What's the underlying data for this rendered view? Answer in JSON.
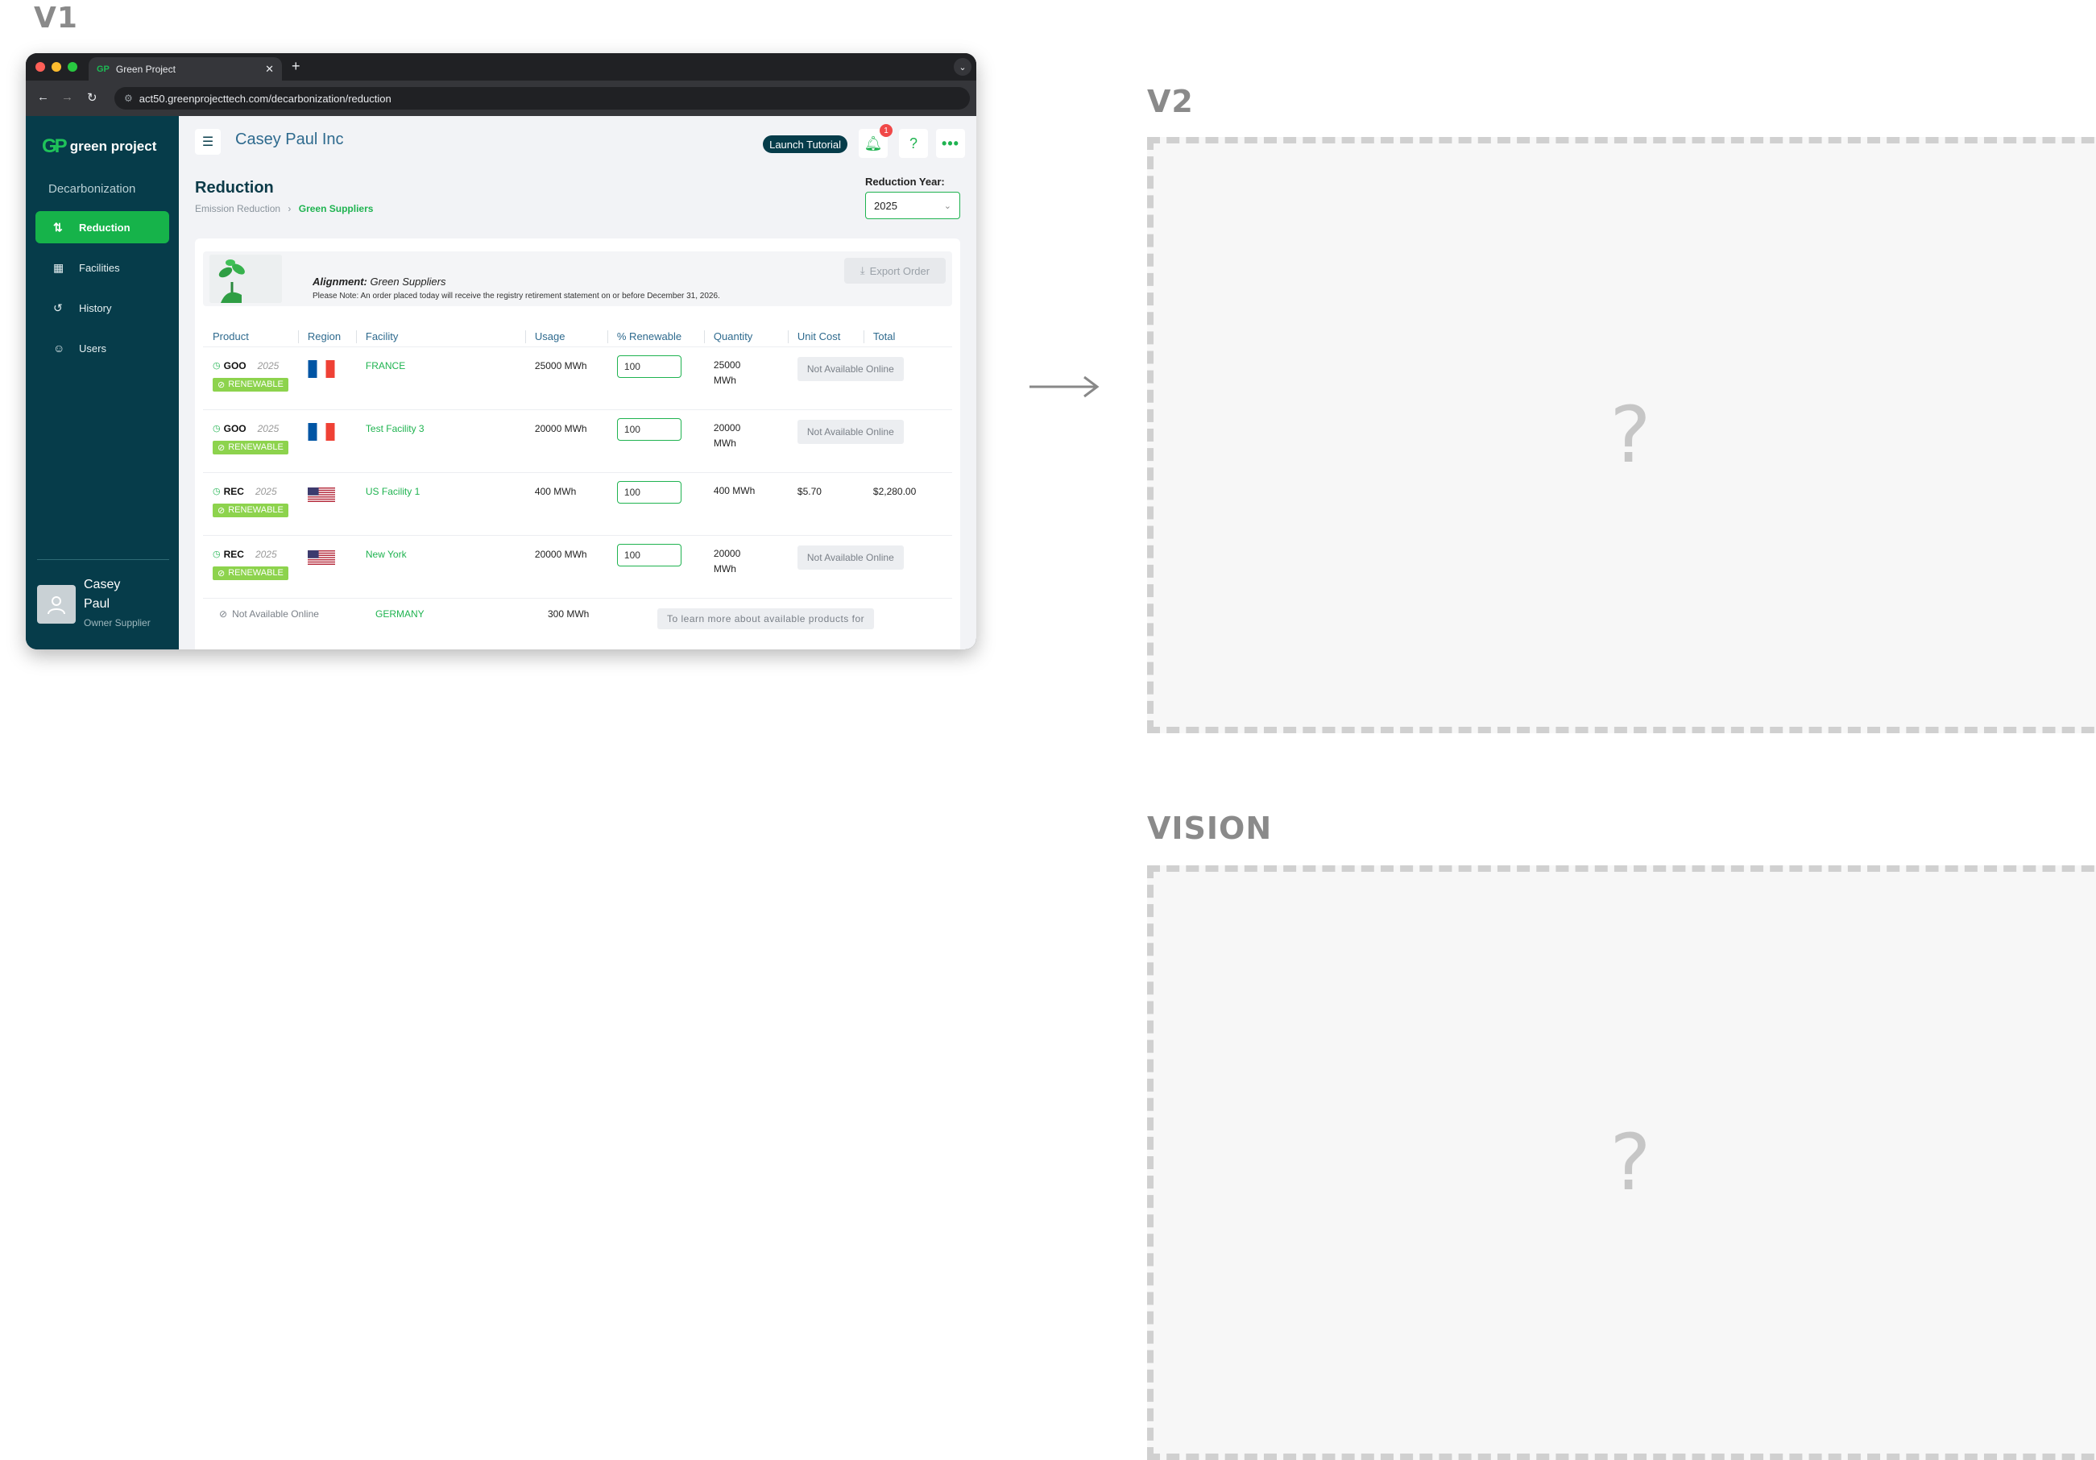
{
  "labels": {
    "v1": "V1",
    "v2": "V2",
    "vision": "VISION",
    "placeholder_mark": "?"
  },
  "browser": {
    "tab_title": "Green Project",
    "tab_favicon": "GP",
    "url": "act50.greenprojecttech.com/decarbonization/reduction"
  },
  "sidebar": {
    "logo_mark": "GP",
    "logo_text": "green project",
    "section": "Decarbonization",
    "items": [
      {
        "label": "Reduction",
        "icon": "reduction-icon",
        "active": true
      },
      {
        "label": "Facilities",
        "icon": "building-icon",
        "active": false
      },
      {
        "label": "History",
        "icon": "history-icon",
        "active": false
      },
      {
        "label": "Users",
        "icon": "user-icon",
        "active": false
      }
    ],
    "user": {
      "name": "Casey Paul",
      "role": "Owner Supplier"
    }
  },
  "header": {
    "company": "Casey Paul Inc",
    "launch_tutorial": "Launch Tutorial",
    "notification_count": "1"
  },
  "page": {
    "title": "Reduction",
    "breadcrumb": [
      "Emission Reduction",
      "Green Suppliers"
    ],
    "year_label": "Reduction Year:",
    "year_value": "2025"
  },
  "info": {
    "alignment_label": "Alignment:",
    "alignment_value": "Green Suppliers",
    "note": "Please Note: An order placed today will receive the registry retirement statement on or before December 31, 2026.",
    "export_label": "Export Order"
  },
  "table": {
    "headers": [
      "Product",
      "Region",
      "Facility",
      "Usage",
      "% Renewable",
      "Quantity",
      "Unit Cost",
      "Total"
    ],
    "renewable_badge": "RENEWABLE",
    "rows": [
      {
        "product": "GOO",
        "year": "2025",
        "region": "france",
        "facility": "FRANCE",
        "usage": "25000 MWh",
        "pct": "100",
        "quantity": "25000 MWh",
        "unit_cost": "",
        "total": "",
        "status": "Not Available Online"
      },
      {
        "product": "GOO",
        "year": "2025",
        "region": "france",
        "facility": "Test Facility 3",
        "usage": "20000 MWh",
        "pct": "100",
        "quantity": "20000 MWh",
        "unit_cost": "",
        "total": "",
        "status": "Not Available Online"
      },
      {
        "product": "REC",
        "year": "2025",
        "region": "usa",
        "facility": "US Facility 1",
        "usage": "400 MWh",
        "pct": "100",
        "quantity": "400 MWh",
        "unit_cost": "$5.70",
        "total": "$2,280.00",
        "status": ""
      },
      {
        "product": "REC",
        "year": "2025",
        "region": "usa",
        "facility": "New York",
        "usage": "20000 MWh",
        "pct": "100",
        "quantity": "20000 MWh",
        "unit_cost": "",
        "total": "",
        "status": "Not Available Online"
      }
    ],
    "partial_row": {
      "status": "Not Available Online",
      "facility": "GERMANY",
      "usage": "300 MWh",
      "message": "To learn more about available products for"
    }
  },
  "colors": {
    "accent": "#1fb350",
    "sidebar": "#063c4a",
    "link": "#2e6a8e"
  }
}
